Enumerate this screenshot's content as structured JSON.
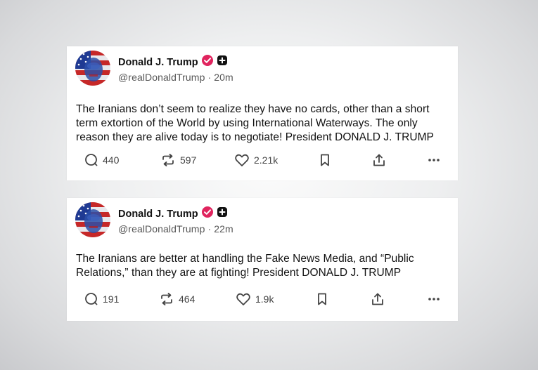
{
  "posts": [
    {
      "author": "Donald J. Trump",
      "handle": "@realDonaldTrump · 20m",
      "text": "The Iranians don’t seem to realize they have no cards, other than a short term extortion of the World by using International Waterways. The only reason they are alive today is to negotiate! President DONALD J. TRUMP",
      "replies": "440",
      "reposts": "597",
      "likes": "2.21k"
    },
    {
      "author": "Donald J. Trump",
      "handle": "@realDonaldTrump · 22m",
      "text": "The Iranians are better at handling the Fake News Media, and “Public Relations,” than they are at fighting! President DONALD J. TRUMP",
      "replies": "191",
      "reposts": "464",
      "likes": "1.9k"
    }
  ],
  "colors": {
    "verified": "#e0245e",
    "text": "#111111",
    "muted": "#555555",
    "card": "#ffffff"
  },
  "icons": [
    "verified-badge-icon",
    "plus-icon",
    "reply-icon",
    "repost-icon",
    "like-icon",
    "bookmark-icon",
    "share-icon",
    "more-icon"
  ]
}
